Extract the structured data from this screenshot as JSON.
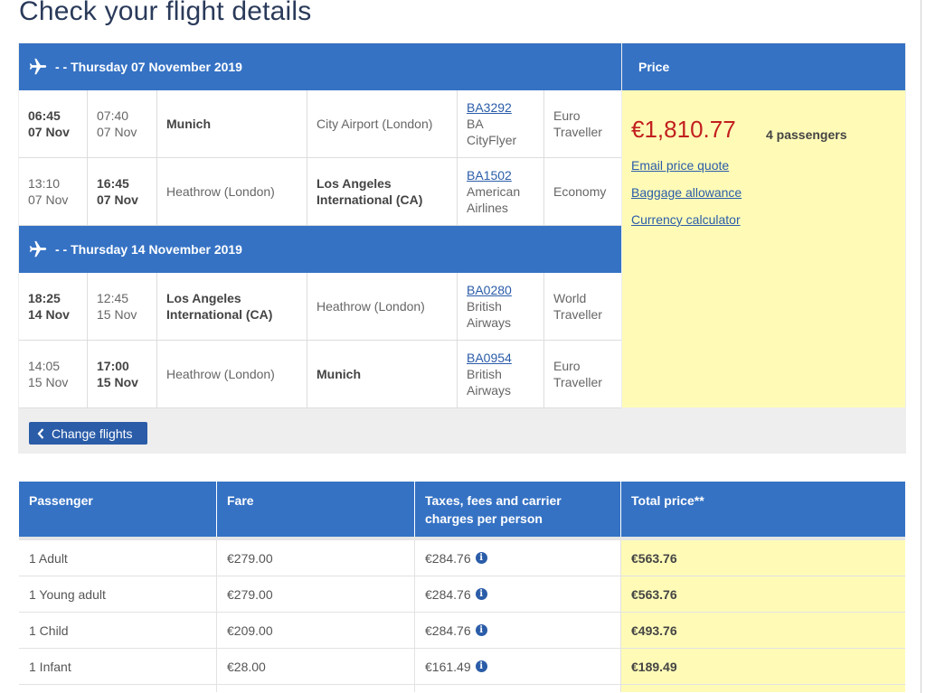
{
  "page": {
    "title": "Check your flight details"
  },
  "outbound": {
    "header": "- - Thursday 07 November 2019",
    "legs": [
      {
        "dep_time": "06:45",
        "dep_date": "07 Nov",
        "arr_time": "07:40",
        "arr_date": "07 Nov",
        "from": "Munich",
        "to": "City Airport (London)",
        "flight_no": "BA3292",
        "carrier": "BA CityFlyer",
        "cabin": "Euro Traveller"
      },
      {
        "dep_time": "13:10",
        "dep_date": "07 Nov",
        "arr_time": "16:45",
        "arr_date": "07 Nov",
        "from": "Heathrow (London)",
        "to": "Los Angeles International (CA)",
        "flight_no": "BA1502",
        "carrier": "American Airlines",
        "cabin": "Economy"
      }
    ]
  },
  "inbound": {
    "header": "- - Thursday 14 November 2019",
    "legs": [
      {
        "dep_time": "18:25",
        "dep_date": "14 Nov",
        "arr_time": "12:45",
        "arr_date": "15 Nov",
        "from": "Los Angeles International (CA)",
        "to": "Heathrow (London)",
        "flight_no": "BA0280",
        "carrier": "British Airways",
        "cabin": "World Traveller"
      },
      {
        "dep_time": "14:05",
        "dep_date": "15 Nov",
        "arr_time": "17:00",
        "arr_date": "15 Nov",
        "from": "Heathrow (London)",
        "to": "Munich",
        "flight_no": "BA0954",
        "carrier": "British Airways",
        "cabin": "Euro Traveller"
      }
    ]
  },
  "price": {
    "header": "Price",
    "total": "€1,810.77",
    "passengers": "4 passengers",
    "links": [
      "Email price quote",
      "Baggage allowance",
      "Currency calculator"
    ]
  },
  "actions": {
    "change_flights": "Change flights"
  },
  "fare_table": {
    "headers": [
      "Passenger",
      "Fare",
      "Taxes, fees and carrier charges per person",
      "Total price**"
    ],
    "rows": [
      {
        "passenger": "1 Adult",
        "fare": "€279.00",
        "taxes": "€284.76",
        "total": "€563.76"
      },
      {
        "passenger": "1 Young adult",
        "fare": "€279.00",
        "taxes": "€284.76",
        "total": "€563.76"
      },
      {
        "passenger": "1 Child",
        "fare": "€209.00",
        "taxes": "€284.76",
        "total": "€493.76"
      },
      {
        "passenger": "1 Infant",
        "fare": "€28.00",
        "taxes": "€161.49",
        "total": "€189.49"
      }
    ]
  },
  "colors": {
    "header_blue": "#3572c4",
    "highlight_yellow": "#fffbb7",
    "price_red": "#c21f1f",
    "link_blue": "#2a5ca8"
  },
  "icons": {
    "plane": "airplane-icon",
    "chevron": "chevron-left-icon",
    "info": "info-icon"
  }
}
